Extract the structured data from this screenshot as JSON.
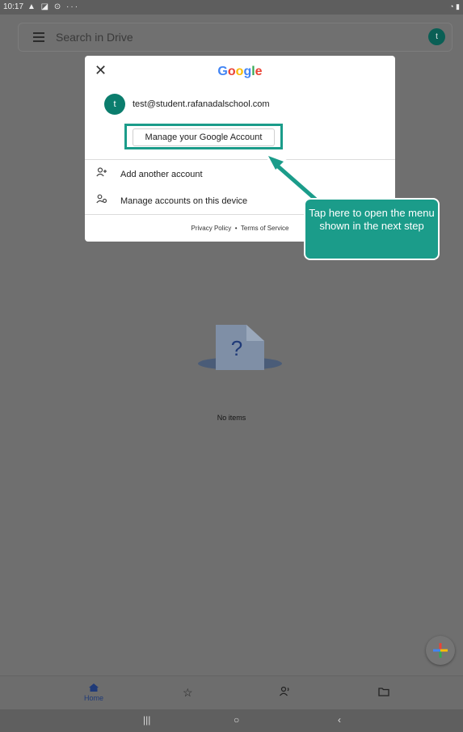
{
  "status_bar": {
    "time": "10:17",
    "icons": "▲ ◪ ⊙ ···"
  },
  "search": {
    "placeholder": "Search in Drive",
    "avatar_letter": "t"
  },
  "dialog": {
    "logo": "Google",
    "account": {
      "avatar_letter": "t",
      "email": "test@student.rafanadalschool.com"
    },
    "manage_button": "Manage your Google Account",
    "menu": [
      {
        "label": "Add another account",
        "icon": "add-person-icon"
      },
      {
        "label": "Manage accounts on this device",
        "icon": "manage-accounts-icon"
      }
    ],
    "footer": {
      "privacy": "Privacy Policy",
      "separator": "•",
      "terms": "Terms of Service"
    }
  },
  "empty_state": {
    "glyph": "?",
    "text": "No items"
  },
  "callout": {
    "text": "Tap here to open the menu shown in the next step"
  },
  "bottom_nav": [
    {
      "label": "Home",
      "icon": "home-icon"
    },
    {
      "label": "",
      "icon": "star-icon"
    },
    {
      "label": "",
      "icon": "shared-icon"
    },
    {
      "label": "",
      "icon": "folder-icon"
    }
  ],
  "colors": {
    "accent": "#1b9c8a",
    "avatar": "#0b7d6d"
  }
}
